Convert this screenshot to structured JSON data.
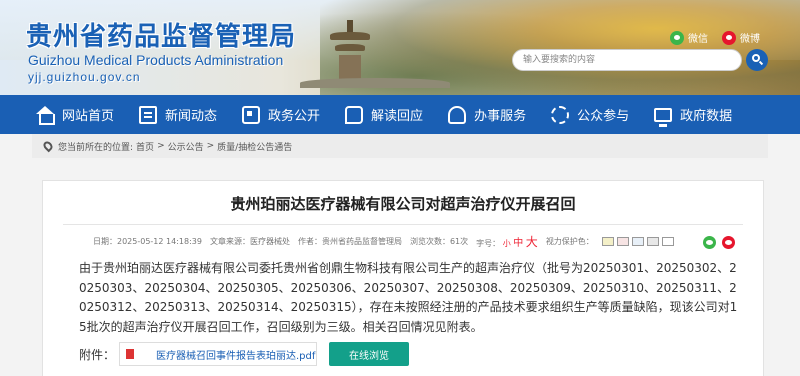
{
  "header": {
    "site_name_cn": "贵州省药品监督管理局",
    "site_name_en": "Guizhou Medical Products Administration",
    "site_url": "yjj.guizhou.gov.cn",
    "share_wechat": "微信",
    "share_weibo": "微博",
    "search_placeholder": "输入要搜索的内容"
  },
  "nav": {
    "items": [
      {
        "label": "网站首页",
        "icon": "home-icon"
      },
      {
        "label": "新闻动态",
        "icon": "document-icon"
      },
      {
        "label": "政务公开",
        "icon": "info-icon"
      },
      {
        "label": "解读回应",
        "icon": "chat-icon"
      },
      {
        "label": "办事服务",
        "icon": "person-icon"
      },
      {
        "label": "公众参与",
        "icon": "handshake-icon"
      },
      {
        "label": "政府数据",
        "icon": "monitor-icon"
      }
    ]
  },
  "breadcrumb": {
    "prefix": "您当前所在的位置:",
    "items": [
      "首页",
      "公示公告",
      "质量/抽检公告通告"
    ],
    "separator": ">"
  },
  "article": {
    "title": "贵州珀丽达医疗器械有限公司对超声治疗仪开展召回",
    "meta": {
      "date": "日期：2025-05-12 14:18:39",
      "source": "文章来源：医疗器械处",
      "author": "作者：贵州省药品监督管理局",
      "views": "浏览次数：61次",
      "font_label": "字号：",
      "font_small": "小",
      "font_mid": "中",
      "font_big": "大",
      "eye_care": "视力保护色："
    },
    "body": "由于贵州珀丽达医疗器械有限公司委托贵州省创鼎生物科技有限公司生产的超声治疗仪（批号为20250301、20250302、20250303、20250304、20250305、20250306、20250307、20250308、20250309、20250310、20250311、20250312、20250313、20250314、20250315），存在未按照经注册的产品技术要求组织生产等质量缺陷，现该公司对15批次的超声治疗仪开展召回工作，召回级别为三级。相关召回情况见附表。",
    "attachment_label": "附件：",
    "attachment_file": "医疗器械召回事件报告表珀丽达.pdf",
    "attachment_button": "在线浏览"
  },
  "colors": {
    "nav_bg": "#1a5fb4",
    "brand_blue": "#1a61b5",
    "button_teal": "#13a08a"
  }
}
